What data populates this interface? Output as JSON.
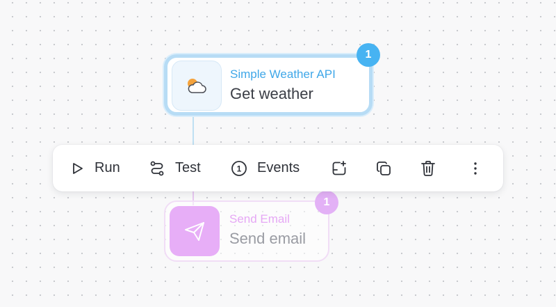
{
  "nodes": {
    "weather": {
      "app_name": "Simple Weather API",
      "action": "Get weather",
      "badge": "1",
      "icon": "partly-cloudy-icon",
      "accent": "#47b3f2"
    },
    "email": {
      "app_name": "Send Email",
      "action": "Send email",
      "badge": "1",
      "icon": "paper-plane-icon",
      "accent": "#e7aef7"
    }
  },
  "toolbar": {
    "run_label": "Run",
    "test_label": "Test",
    "events_label": "Events",
    "events_count": "1",
    "icons": [
      "play-icon",
      "route-icon",
      "add-step-icon",
      "duplicate-icon",
      "trash-icon",
      "more-vertical-icon"
    ]
  }
}
